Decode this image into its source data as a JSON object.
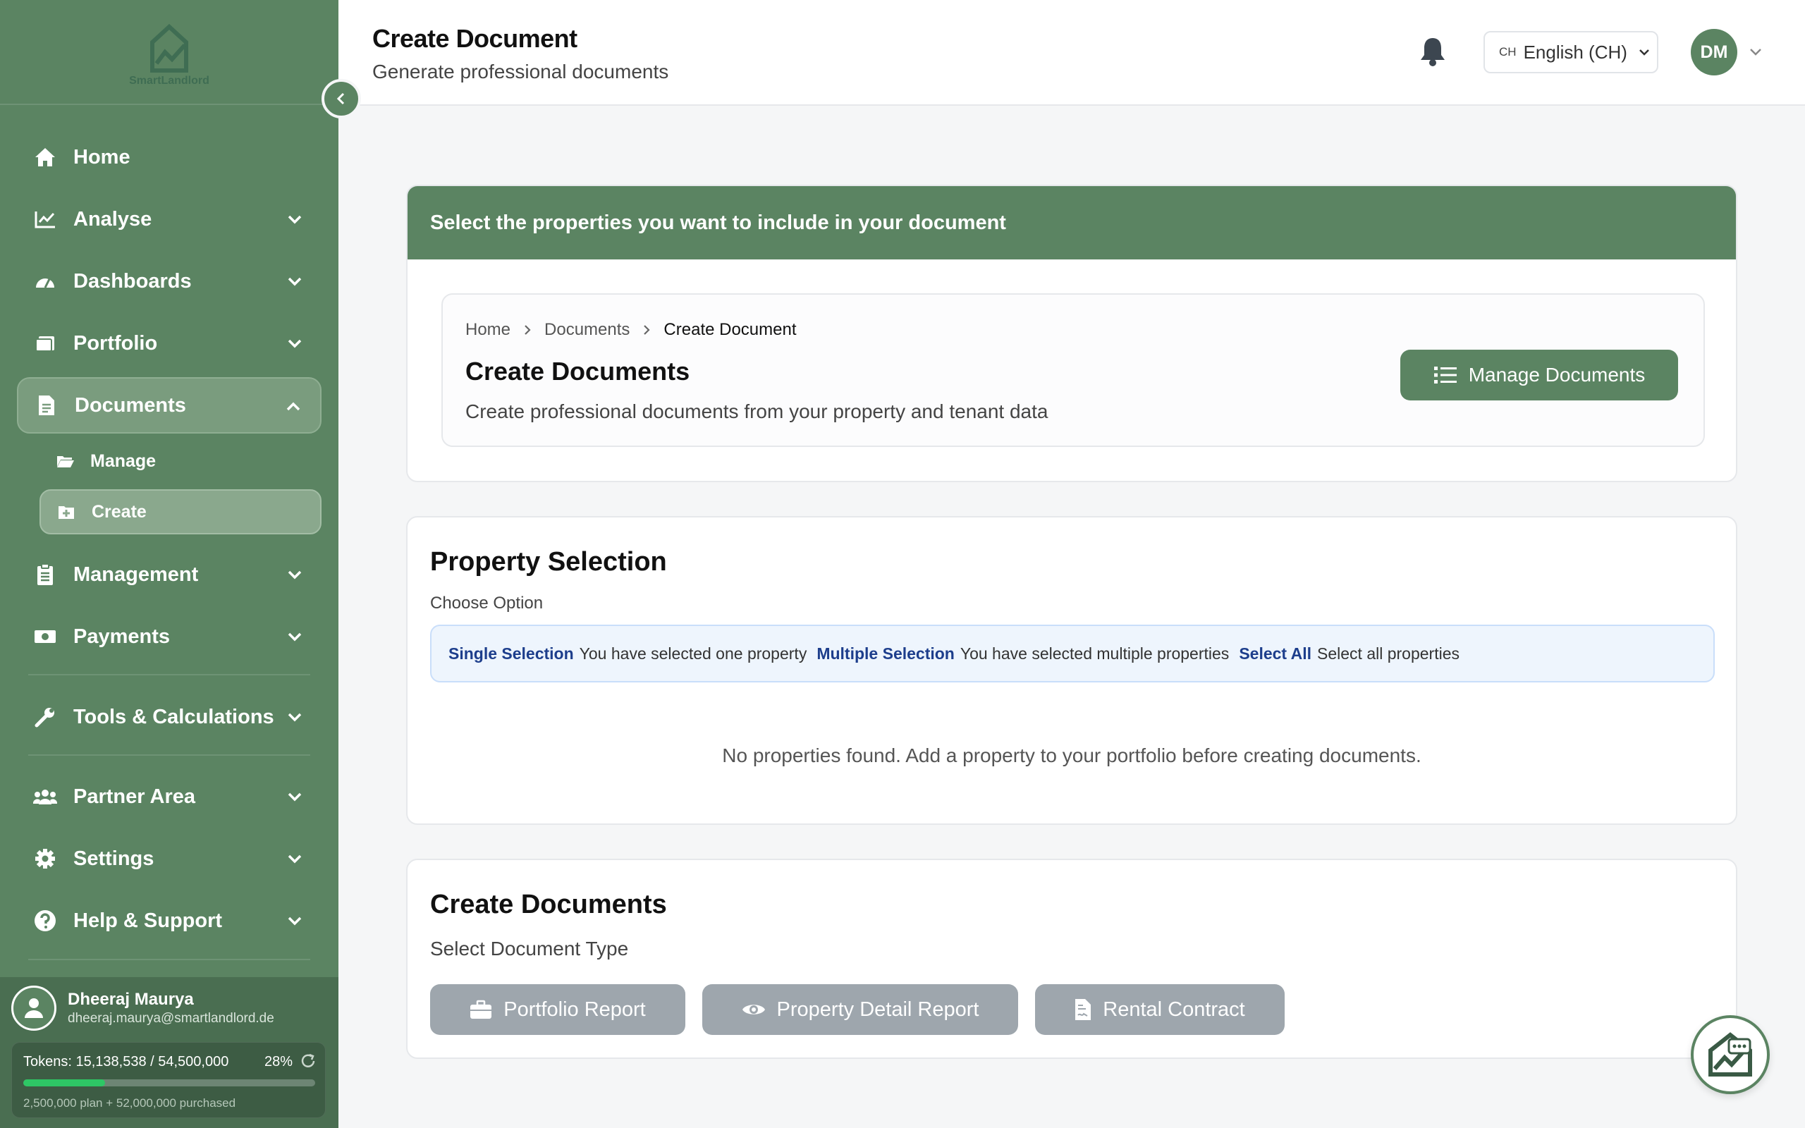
{
  "brand": {
    "name": "SmartLandlord"
  },
  "sidebar": {
    "items": [
      {
        "label": "Home",
        "icon": "home-icon"
      },
      {
        "label": "Analyse",
        "icon": "chart-line-icon"
      },
      {
        "label": "Dashboards",
        "icon": "gauge-icon"
      },
      {
        "label": "Portfolio",
        "icon": "portfolio-icon"
      },
      {
        "label": "Documents",
        "icon": "document-icon"
      },
      {
        "label": "Management",
        "icon": "clipboard-icon"
      },
      {
        "label": "Payments",
        "icon": "money-icon"
      },
      {
        "label": "Tools & Calculations",
        "icon": "wrench-icon"
      },
      {
        "label": "Partner Area",
        "icon": "users-icon"
      },
      {
        "label": "Settings",
        "icon": "gear-icon"
      },
      {
        "label": "Help & Support",
        "icon": "question-icon"
      }
    ],
    "documents_sub": [
      {
        "label": "Manage",
        "icon": "folder-open-icon"
      },
      {
        "label": "Create",
        "icon": "file-plus-icon"
      }
    ]
  },
  "user": {
    "name": "Dheeraj Maurya",
    "email": "dheeraj.maurya@smartlandlord.de",
    "tokens_label": "Tokens: 15,138,538 / 54,500,000",
    "tokens_pct": "28%",
    "tokens_progress": 0.28,
    "tokens_sub": "2,500,000 plan + 52,000,000 purchased"
  },
  "header": {
    "title": "Create Document",
    "subtitle": "Generate professional documents",
    "lang_flag": "CH",
    "language": "English (CH)",
    "avatar_initials": "DM"
  },
  "intro_card": {
    "banner": "Select the properties you want to include in your document",
    "breadcrumb": [
      "Home",
      "Documents",
      "Create Document"
    ],
    "title": "Create Documents",
    "subtitle": "Create professional documents from your property and tenant data",
    "manage_button": "Manage Documents"
  },
  "property_selection": {
    "title": "Property Selection",
    "choose_label": "Choose Option",
    "options": [
      {
        "title": "Single Selection",
        "desc": "You have selected one property"
      },
      {
        "title": "Multiple Selection",
        "desc": "You have selected multiple properties"
      },
      {
        "title": "Select All",
        "desc": "Select all properties"
      }
    ],
    "empty_message": "No properties found. Add a property to your portfolio before creating documents."
  },
  "create_documents": {
    "title": "Create Documents",
    "type_label": "Select Document Type",
    "buttons": [
      {
        "label": "Portfolio Report",
        "icon": "briefcase-icon"
      },
      {
        "label": "Property Detail Report",
        "icon": "eye-icon"
      },
      {
        "label": "Rental Contract",
        "icon": "file-contract-icon"
      }
    ]
  },
  "colors": {
    "brand_green": "#5b8462",
    "disabled_button": "#9ea6ad",
    "progress_fill": "#2ec765"
  }
}
